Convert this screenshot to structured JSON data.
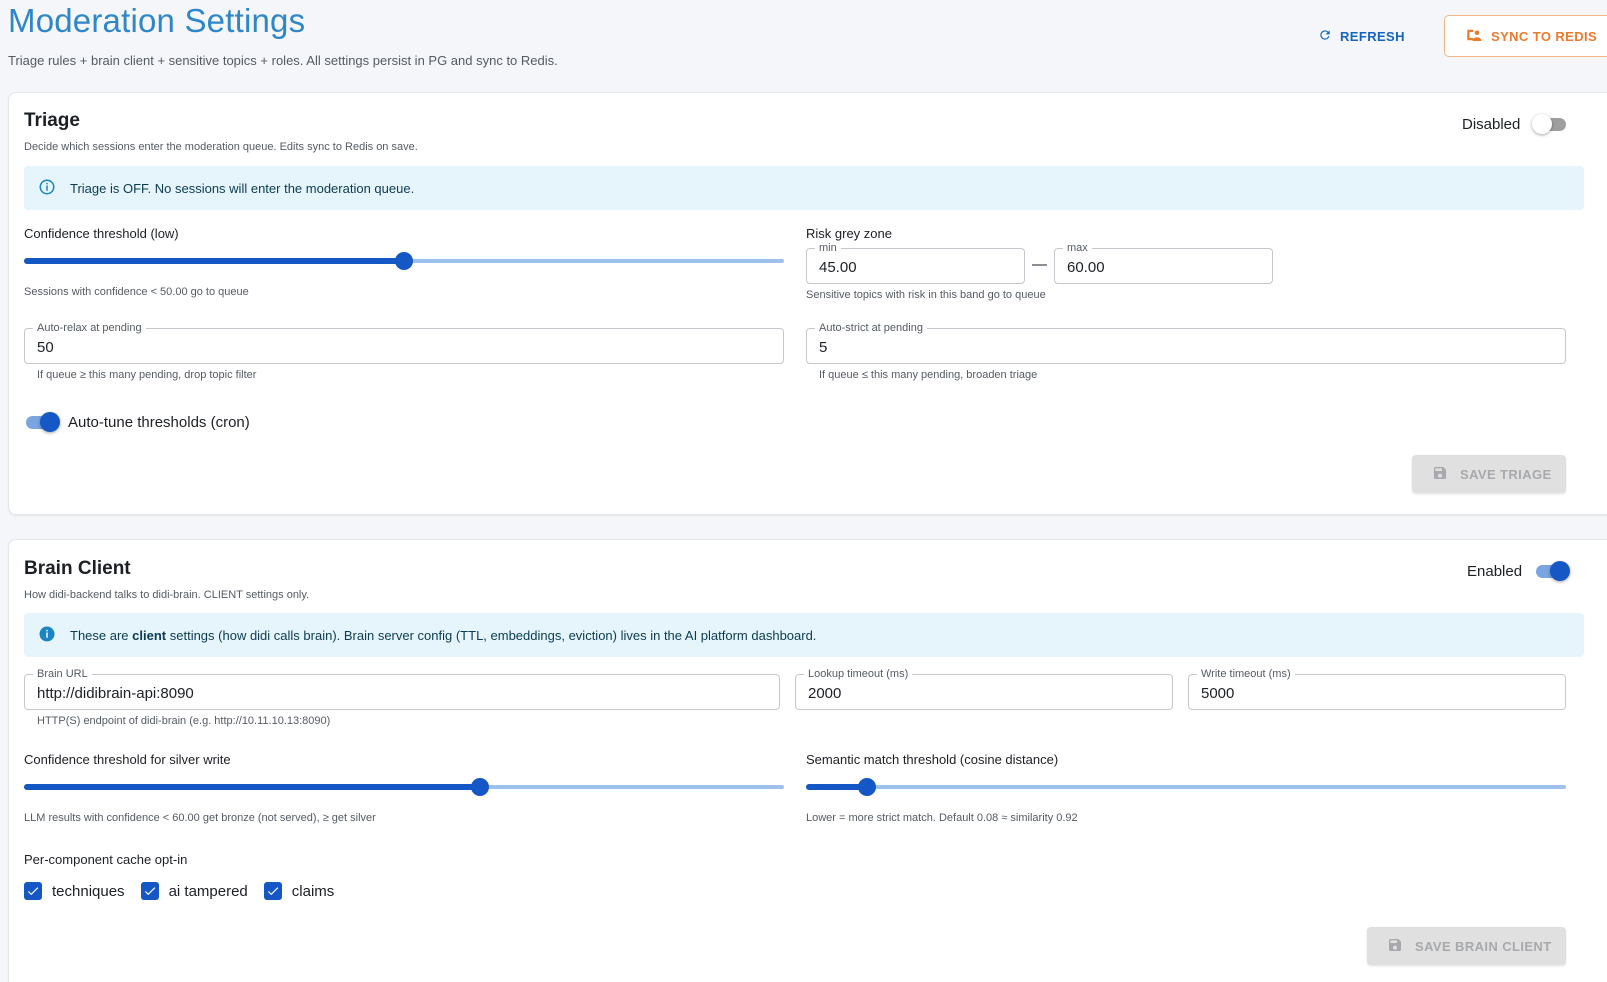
{
  "header": {
    "title": "Moderation Settings",
    "subtitle": "Triage rules + brain client + sensitive topics + roles. All settings persist in PG and sync to Redis.",
    "refresh_label": "REFRESH",
    "sync_label": "SYNC TO REDIS"
  },
  "triage": {
    "title": "Triage",
    "description": "Decide which sessions enter the moderation queue. Edits sync to Redis on save.",
    "status_label": "Disabled",
    "enabled": false,
    "alert_text": "Triage is OFF. No sessions will enter the moderation queue.",
    "confidence_label": "Confidence threshold (low)",
    "confidence_value": 0.5,
    "confidence_help": "Sessions with confidence < 50.00 go to queue",
    "grey_zone_label": "Risk grey zone",
    "grey_min_label": "min",
    "grey_min_value": "45.00",
    "grey_dash": "—",
    "grey_max_label": "max",
    "grey_max_value": "60.00",
    "grey_zone_help": "Sensitive topics with risk in this band go to queue",
    "auto_relax_label": "Auto-relax at pending",
    "auto_relax_value": "50",
    "auto_relax_help": "If queue ≥ this many pending, drop topic filter",
    "auto_strict_label": "Auto-strict at pending",
    "auto_strict_value": "5",
    "auto_strict_help": "If queue ≤ this many pending, broaden triage",
    "autotune_label": "Auto-tune thresholds (cron)",
    "autotune_on": true,
    "save_label": "SAVE TRIAGE"
  },
  "brain": {
    "title": "Brain Client",
    "description": "How didi-backend talks to didi-brain. CLIENT settings only.",
    "status_label": "Enabled",
    "enabled": true,
    "alert_pre": "These are ",
    "alert_bold": "client",
    "alert_post": " settings (how didi calls brain). Brain server config (TTL, embeddings, eviction) lives in the AI platform dashboard.",
    "url_label": "Brain URL",
    "url_value": "http://didibrain-api:8090",
    "url_help": "HTTP(S) endpoint of didi-brain (e.g. http://10.11.10.13:8090)",
    "lookup_label": "Lookup timeout (ms)",
    "lookup_value": "2000",
    "write_label": "Write timeout (ms)",
    "write_value": "5000",
    "silver_label": "Confidence threshold for silver write",
    "silver_value": 0.6,
    "silver_help": "LLM results with confidence < 60.00 get bronze (not served), ≥ get silver",
    "semantic_label": "Semantic match threshold (cosine distance)",
    "semantic_value": 0.08,
    "semantic_help": "Lower = more strict match. Default 0.08 ≈ similarity 0.92",
    "cache_label": "Per-component cache opt-in",
    "cache_items": [
      "techniques",
      "ai tampered",
      "claims"
    ],
    "save_label": "SAVE BRAIN CLIENT"
  },
  "colors": {
    "accent": "#1557c4",
    "title": "#2f86c9",
    "sync": "#ec7a2d",
    "alert_bg": "#e5f5fb"
  }
}
